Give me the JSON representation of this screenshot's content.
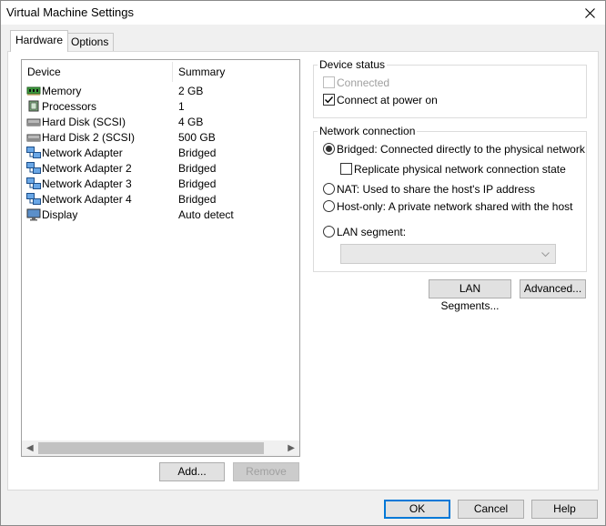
{
  "window": {
    "title": "Virtual Machine Settings"
  },
  "tabs": [
    {
      "label": "Hardware",
      "active": true
    },
    {
      "label": "Options",
      "active": false
    }
  ],
  "device_list": {
    "columns": [
      "Device",
      "Summary"
    ],
    "rows": [
      {
        "name": "Memory",
        "summary": "2 GB",
        "icon": "memory-icon"
      },
      {
        "name": "Processors",
        "summary": "1",
        "icon": "processor-icon"
      },
      {
        "name": "Hard Disk (SCSI)",
        "summary": "4 GB",
        "icon": "hard-disk-icon"
      },
      {
        "name": "Hard Disk 2 (SCSI)",
        "summary": "500 GB",
        "icon": "hard-disk-icon"
      },
      {
        "name": "Network Adapter",
        "summary": "Bridged",
        "icon": "network-adapter-icon"
      },
      {
        "name": "Network Adapter 2",
        "summary": "Bridged",
        "icon": "network-adapter-icon"
      },
      {
        "name": "Network Adapter 3",
        "summary": "Bridged",
        "icon": "network-adapter-icon"
      },
      {
        "name": "Network Adapter 4",
        "summary": "Bridged",
        "icon": "network-adapter-icon"
      },
      {
        "name": "Display",
        "summary": "Auto detect",
        "icon": "display-icon"
      }
    ]
  },
  "list_buttons": {
    "add": "Add...",
    "remove": "Remove"
  },
  "device_status": {
    "title": "Device status",
    "connected": {
      "label": "Connected",
      "checked": false,
      "enabled": false
    },
    "connect_at_power_on": {
      "label": "Connect at power on",
      "checked": true
    }
  },
  "network_connection": {
    "title": "Network connection",
    "bridged": "Bridged: Connected directly to the physical network",
    "replicate": "Replicate physical network connection state",
    "nat": "NAT: Used to share the host's IP address",
    "host_only": "Host-only: A private network shared with the host",
    "lan_segment": "LAN segment:",
    "selected": "bridged"
  },
  "network_buttons": {
    "lan_segments": "LAN Segments...",
    "advanced": "Advanced..."
  },
  "dialog_buttons": {
    "ok": "OK",
    "cancel": "Cancel",
    "help": "Help"
  }
}
